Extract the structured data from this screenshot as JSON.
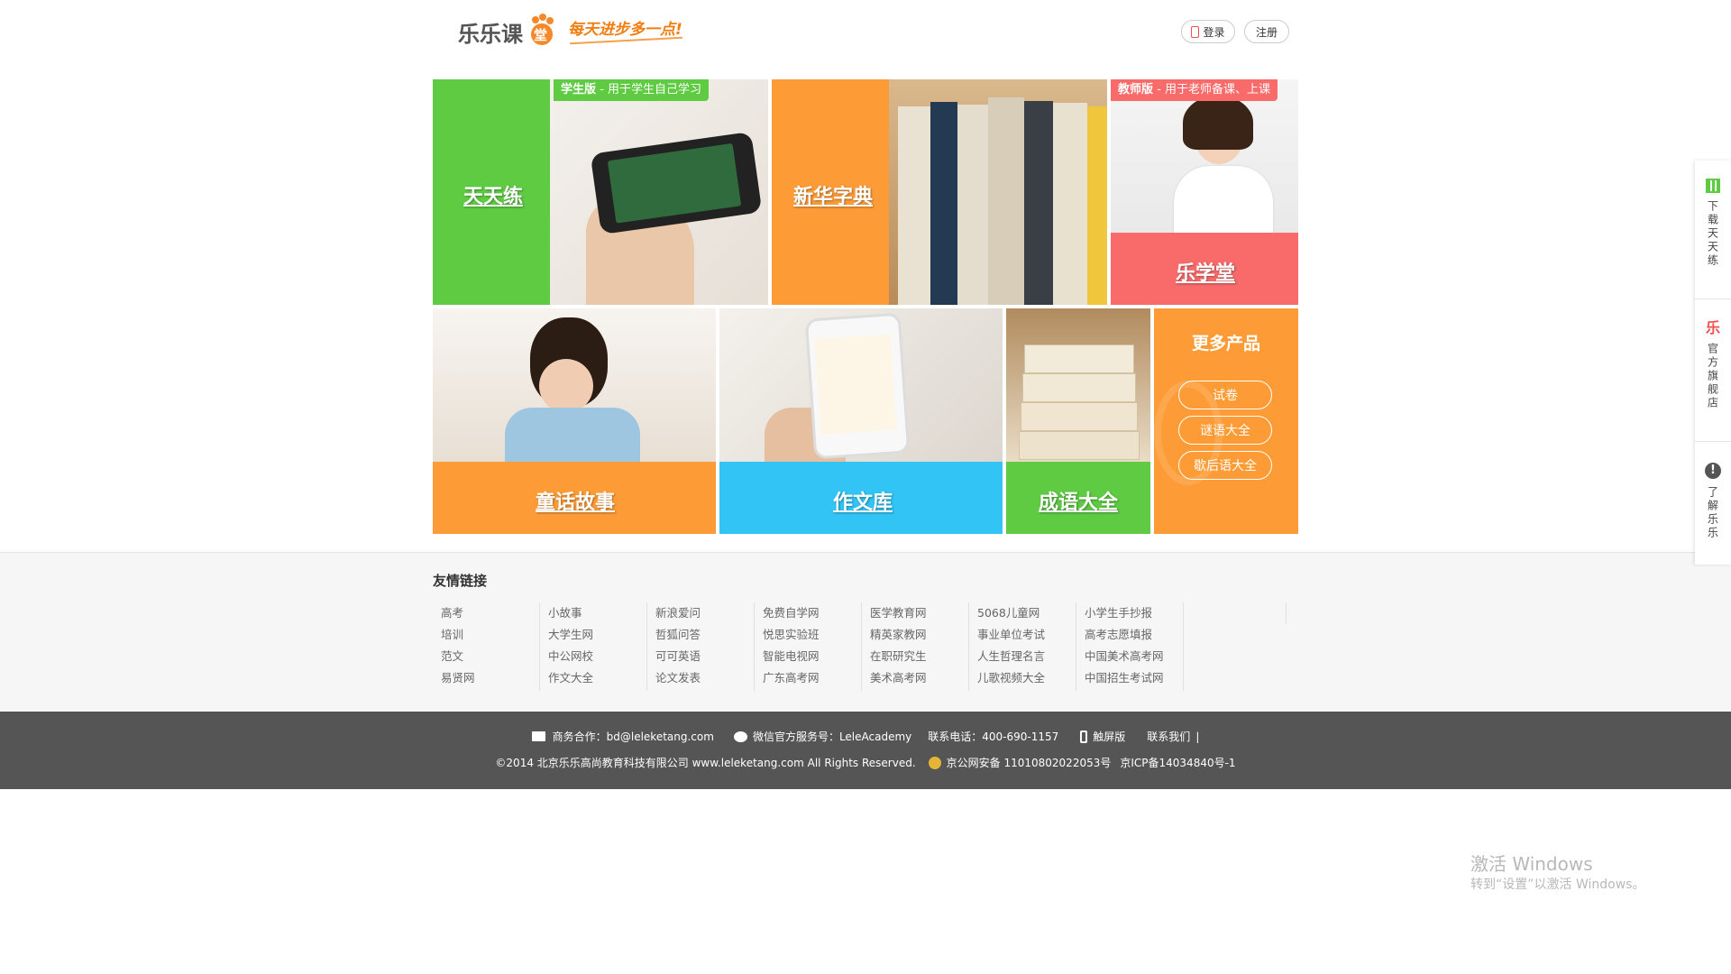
{
  "header": {
    "logo_text": "乐乐课堂",
    "slogan": "每天进步多一点!",
    "login_label": "登录",
    "register_label": "注册"
  },
  "tiles": {
    "tiantianlian": {
      "title": "天天练",
      "tag_bold": "学生版",
      "tag_text": " - 用于学生自己学习"
    },
    "xinhua": {
      "title": "新华字典"
    },
    "lexuetang": {
      "title": "乐学堂",
      "tag_bold": "教师版",
      "tag_text": " - 用于老师备课、上课"
    },
    "tonghua": {
      "title": "童话故事"
    },
    "zuowen": {
      "title": "作文库"
    },
    "chengyu": {
      "title": "成语大全"
    },
    "more": {
      "title": "更多产品",
      "items": [
        "试卷",
        "谜语大全",
        "歇后语大全"
      ]
    }
  },
  "links": {
    "title": "友情链接",
    "columns": [
      [
        "高考",
        "培训",
        "范文",
        "易贤网"
      ],
      [
        "小故事",
        "大学生网",
        "中公网校",
        "作文大全"
      ],
      [
        "新浪爱问",
        "哲狐问答",
        "可可英语",
        "论文发表"
      ],
      [
        "免费自学网",
        "悦思实验班",
        "智能电视网",
        "广东高考网"
      ],
      [
        "医学教育网",
        "精英家教网",
        "在职研究生",
        "美术高考网"
      ],
      [
        "5068儿童网",
        "事业单位考试",
        "人生哲理名言",
        "儿歌视频大全"
      ],
      [
        "小学生手抄报",
        "高考志愿填报",
        "中国美术高考网",
        "中国招生考试网"
      ]
    ]
  },
  "footer": {
    "business": "商务合作：bd@leleketang.com",
    "wechat": "微信官方服务号：LeleAcademy",
    "phone": "联系电话：400-690-1157",
    "touch": "触屏版",
    "contact": "联系我们",
    "copyright": "©2014 北京乐乐高尚教育科技有限公司 www.leleketang.com All Rights Reserved.",
    "police": "京公网安备 11010802022053号",
    "icp": "京ICP备14034840号-1"
  },
  "sidebar": {
    "download_icon_text": "",
    "download": "下载天天练",
    "store_icon_text": "乐",
    "store": "官方旗舰店",
    "about": "了解乐乐"
  },
  "watermark": {
    "line1": "激活 Windows",
    "line2": "转到“设置”以激活 Windows。"
  },
  "colors": {
    "green": "#5ecb43",
    "orange": "#fd9c37",
    "red": "#f96a6a",
    "blue": "#31c4f5",
    "footer": "#555555"
  }
}
